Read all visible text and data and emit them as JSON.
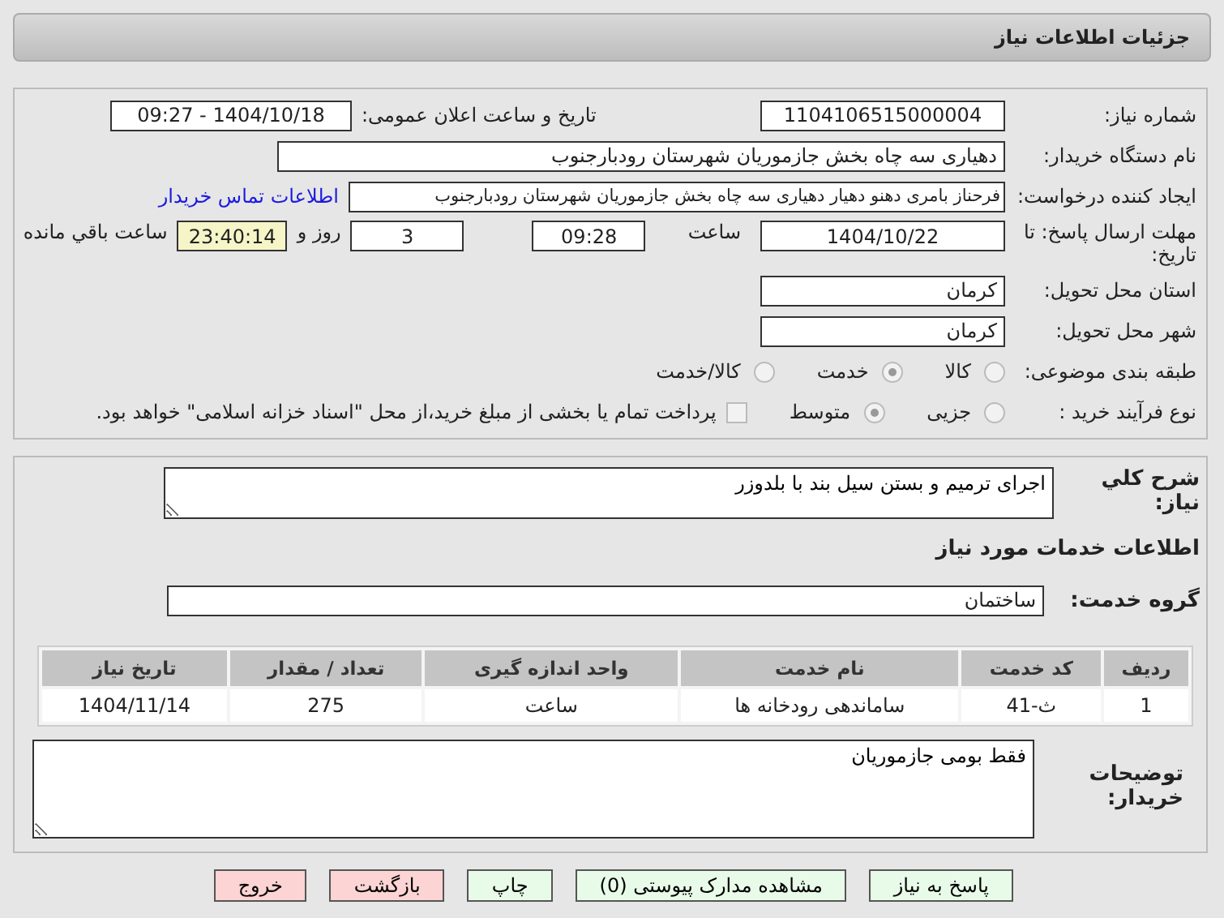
{
  "header": {
    "title": "جزئیات اطلاعات نیاز"
  },
  "details": {
    "need_number": {
      "label": "شماره نیاز:",
      "value": "1104106515000004"
    },
    "announce": {
      "label": "تاریخ و ساعت اعلان عمومی:",
      "value": "1404/10/18 - 09:27"
    },
    "buyer": {
      "label": "نام دستگاه خریدار:",
      "value": "دهیاری سه چاه بخش جازموریان شهرستان رودبارجنوب"
    },
    "requester": {
      "label": "ایجاد کننده درخواست:",
      "value": "فرحناز بامری دهنو دهیار دهیاری سه چاه بخش جازموریان شهرستان رودبارجنوب",
      "link": "اطلاعات تماس خریدار"
    },
    "deadline": {
      "label": "مهلت ارسال پاسخ: تا تاریخ:",
      "date": "1404/10/22",
      "time_label": "ساعت",
      "time": "09:28",
      "days": "3",
      "days_label": "روز و",
      "remaining": "23:40:14",
      "remaining_label": "ساعت باقي مانده"
    },
    "province": {
      "label": "استان محل تحویل:",
      "value": "کرمان"
    },
    "city": {
      "label": "شهر محل تحویل:",
      "value": "کرمان"
    },
    "category": {
      "label": "طبقه بندی موضوعی:",
      "options": [
        {
          "label": "کالا",
          "selected": false
        },
        {
          "label": "خدمت",
          "selected": true
        },
        {
          "label": "کالا/خدمت",
          "selected": false
        }
      ]
    },
    "process": {
      "label": "نوع فرآیند خرید :",
      "options": [
        {
          "label": "جزیی",
          "selected": false
        },
        {
          "label": "متوسط",
          "selected": true
        }
      ],
      "prepay": {
        "checked": false,
        "text": "پرداخت تمام یا بخشی از مبلغ خرید،از محل \"اسناد خزانه اسلامی\" خواهد بود."
      }
    }
  },
  "summary": {
    "label": "شرح کلي نیاز:",
    "value": "اجرای ترمیم و بستن سیل بند با بلدوزر"
  },
  "services_title": "اطلاعات خدمات مورد نیاز",
  "service_group": {
    "label": "گروه خدمت:",
    "value": "ساختمان"
  },
  "table": {
    "columns": [
      "ردیف",
      "کد خدمت",
      "نام خدمت",
      "واحد اندازه گیری",
      "تعداد / مقدار",
      "تاریخ نیاز"
    ],
    "rows": [
      [
        "1",
        "ث-41",
        "ساماندهی رودخانه ها",
        "ساعت",
        "275",
        "1404/11/14"
      ]
    ]
  },
  "buyer_notes": {
    "label": "توضیحات خریدار:",
    "value": "فقط بومی جازموریان"
  },
  "buttons": [
    {
      "label": "پاسخ به نیاز",
      "kind": "normal"
    },
    {
      "label": "مشاهده مدارک پیوستی (0)",
      "kind": "normal"
    },
    {
      "label": "چاپ",
      "kind": "normal"
    },
    {
      "label": "بازگشت",
      "kind": "danger"
    },
    {
      "label": "خروج",
      "kind": "danger"
    }
  ]
}
